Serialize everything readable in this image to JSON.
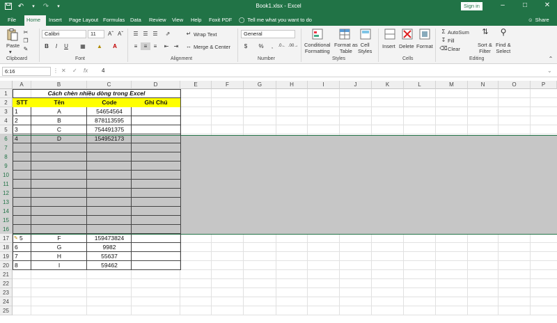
{
  "window": {
    "title": "Book1.xlsx  -  Excel",
    "signin": "Sign in"
  },
  "tabs": [
    "File",
    "Home",
    "Insert",
    "Page Layout",
    "Formulas",
    "Data",
    "Review",
    "View",
    "Help",
    "Foxit PDF"
  ],
  "active_tab": "Home",
  "tellme": "Tell me what you want to do",
  "share": "Share",
  "ribbon": {
    "clipboard": {
      "label": "Clipboard",
      "paste": "Paste"
    },
    "font": {
      "label": "Font",
      "name": "Calibri",
      "size": "11"
    },
    "alignment": {
      "label": "Alignment",
      "wrap": "Wrap Text",
      "merge": "Merge & Center"
    },
    "number": {
      "label": "Number",
      "format": "General",
      "currency": "$",
      "percent": "%"
    },
    "styles": {
      "label": "Styles",
      "conditional": [
        "Conditional",
        "Formatting"
      ],
      "format_table": [
        "Format as",
        "Table"
      ],
      "cell_styles": [
        "Cell",
        "Styles"
      ]
    },
    "cells": {
      "label": "Cells",
      "insert": "Insert",
      "delete": "Delete",
      "format": "Format"
    },
    "editing": {
      "label": "Editing",
      "autosum": "AutoSum",
      "fill": "Fill",
      "clear": "Clear",
      "sort": [
        "Sort &",
        "Filter"
      ],
      "find": [
        "Find &",
        "Select"
      ]
    }
  },
  "formula_bar": {
    "name_box": "6:16",
    "fx": "fx",
    "value": "4"
  },
  "columns": [
    "A",
    "B",
    "C",
    "D",
    "E",
    "F",
    "G",
    "H",
    "I",
    "J",
    "K",
    "L",
    "M",
    "N",
    "O",
    "P"
  ],
  "rows": [
    "1",
    "2",
    "3",
    "4",
    "5",
    "6",
    "7",
    "8",
    "9",
    "10",
    "11",
    "12",
    "13",
    "14",
    "15",
    "16",
    "17",
    "18",
    "19",
    "20",
    "21",
    "22",
    "23",
    "24",
    "25"
  ],
  "sheet": {
    "title": "Cách chèn nhiều dòng trong Excel",
    "headers": [
      "STT",
      "Tên",
      "Code",
      "Ghi Chú"
    ],
    "data_top": [
      [
        "1",
        "A",
        "54654564",
        ""
      ],
      [
        "2",
        "B",
        "878113595",
        ""
      ],
      [
        "3",
        "C",
        "754491375",
        ""
      ],
      [
        "4",
        "D",
        "154952173",
        ""
      ]
    ],
    "data_bottom": [
      [
        "5",
        "F",
        "159473824",
        ""
      ],
      [
        "6",
        "G",
        "9982",
        ""
      ],
      [
        "7",
        "H",
        "55637",
        ""
      ],
      [
        "8",
        "I",
        "59462",
        ""
      ]
    ]
  },
  "colors": {
    "excel_green": "#217346",
    "header_yellow": "#ffff00",
    "selection_gray": "#c6c6c6"
  }
}
